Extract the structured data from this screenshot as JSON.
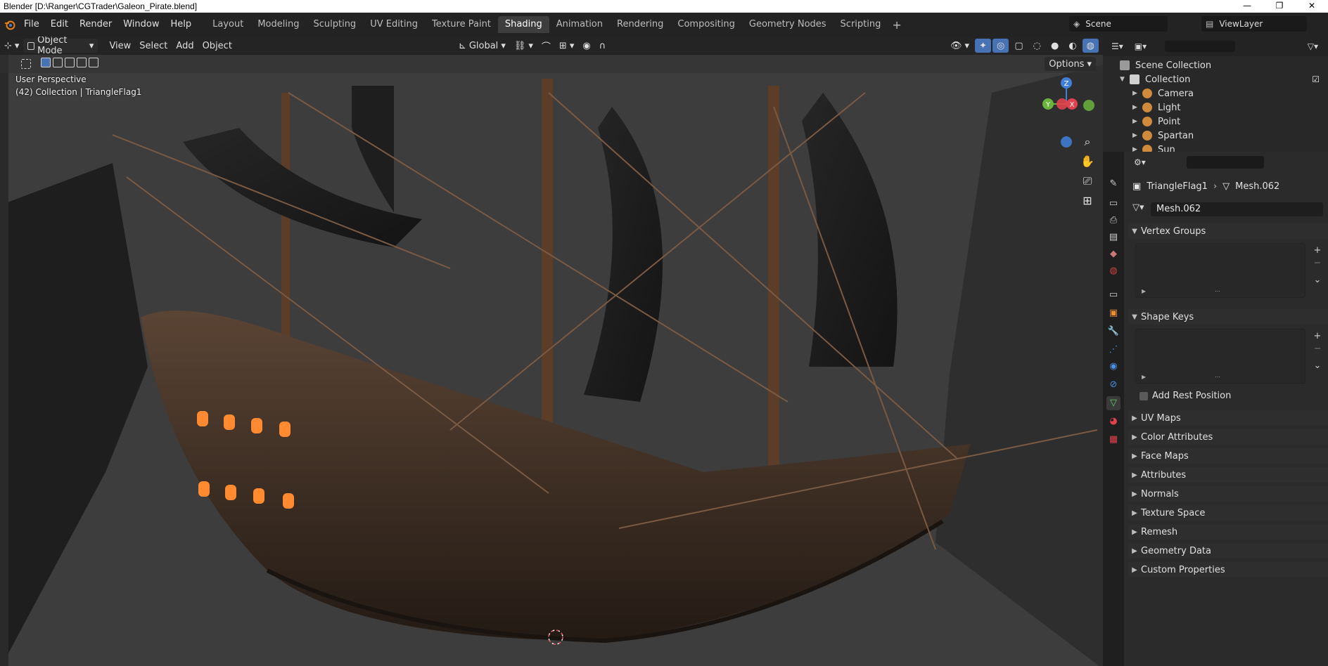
{
  "window": {
    "title": "Blender [D:\\Ranger\\CGTrader\\Galeon_Pirate.blend]",
    "controls": [
      "—",
      "❐",
      "✕"
    ]
  },
  "menu": [
    "File",
    "Edit",
    "Render",
    "Window",
    "Help"
  ],
  "workspaces": [
    "Layout",
    "Modeling",
    "Sculpting",
    "UV Editing",
    "Texture Paint",
    "Shading",
    "Animation",
    "Rendering",
    "Compositing",
    "Geometry Nodes",
    "Scripting"
  ],
  "active_workspace": "Shading",
  "scene": {
    "scene_name": "Scene",
    "view_layer": "ViewLayer"
  },
  "viewport": {
    "mode": "Object Mode",
    "menus": [
      "View",
      "Select",
      "Add",
      "Object"
    ],
    "transform_orientation": "Global",
    "options_label": "Options",
    "perspective_label": "User Perspective",
    "collection_label": "(42) Collection | TriangleFlag1",
    "gizmo_axes": {
      "z": "Z",
      "y": "Y",
      "x": "X"
    }
  },
  "outliner": {
    "root": "Scene Collection",
    "collection": "Collection",
    "items": [
      {
        "name": "Camera",
        "icon": "camera-icon"
      },
      {
        "name": "Light",
        "icon": "light-icon"
      },
      {
        "name": "Point",
        "icon": "point-light-icon"
      },
      {
        "name": "Spartan",
        "icon": "armature-icon"
      },
      {
        "name": "Sun",
        "icon": "sun-icon"
      }
    ]
  },
  "properties": {
    "object_name": "TriangleFlag1",
    "mesh_name": "Mesh.062",
    "mesh_field": "Mesh.062",
    "panels": {
      "vertex_groups": "Vertex Groups",
      "shape_keys": "Shape Keys",
      "add_rest_position": "Add Rest Position",
      "collapsed": [
        "UV Maps",
        "Color Attributes",
        "Face Maps",
        "Attributes",
        "Normals",
        "Texture Space",
        "Remesh",
        "Geometry Data",
        "Custom Properties"
      ]
    }
  },
  "colors": {
    "accent_blue": "#4772b3",
    "active_tab": "#3d3d3d",
    "axis_x": "#e0424e",
    "axis_y": "#6bb33c",
    "axis_z": "#3f7fd9"
  }
}
